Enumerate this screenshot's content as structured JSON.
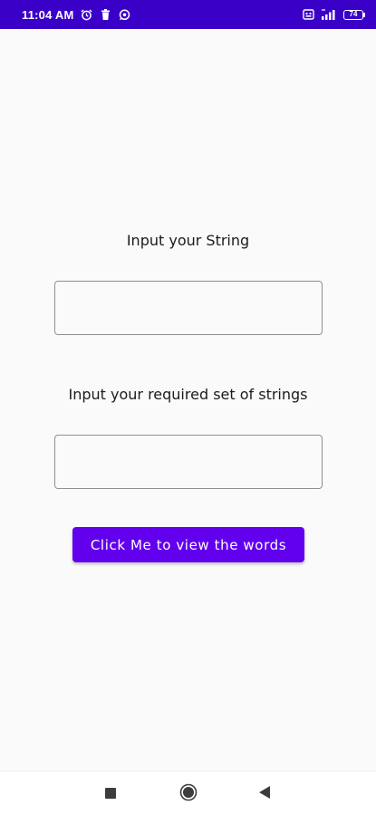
{
  "status_bar": {
    "time": "11:04 AM",
    "battery_level": "74",
    "background_color": "#3a00c8",
    "left_icons": [
      "alarm-icon",
      "delete-icon",
      "whatsapp-icon"
    ],
    "right_icons": [
      "sim-icon",
      "signal-icon",
      "battery-icon"
    ]
  },
  "form": {
    "string_label": "Input your String",
    "string_value": "",
    "strings_set_label": "Input your required set of strings",
    "strings_set_value": "",
    "submit_label": "Click Me to view the words",
    "accent_color": "#6200ee"
  },
  "nav_bar": {
    "buttons": [
      "recents-icon",
      "home-icon",
      "back-icon"
    ]
  }
}
